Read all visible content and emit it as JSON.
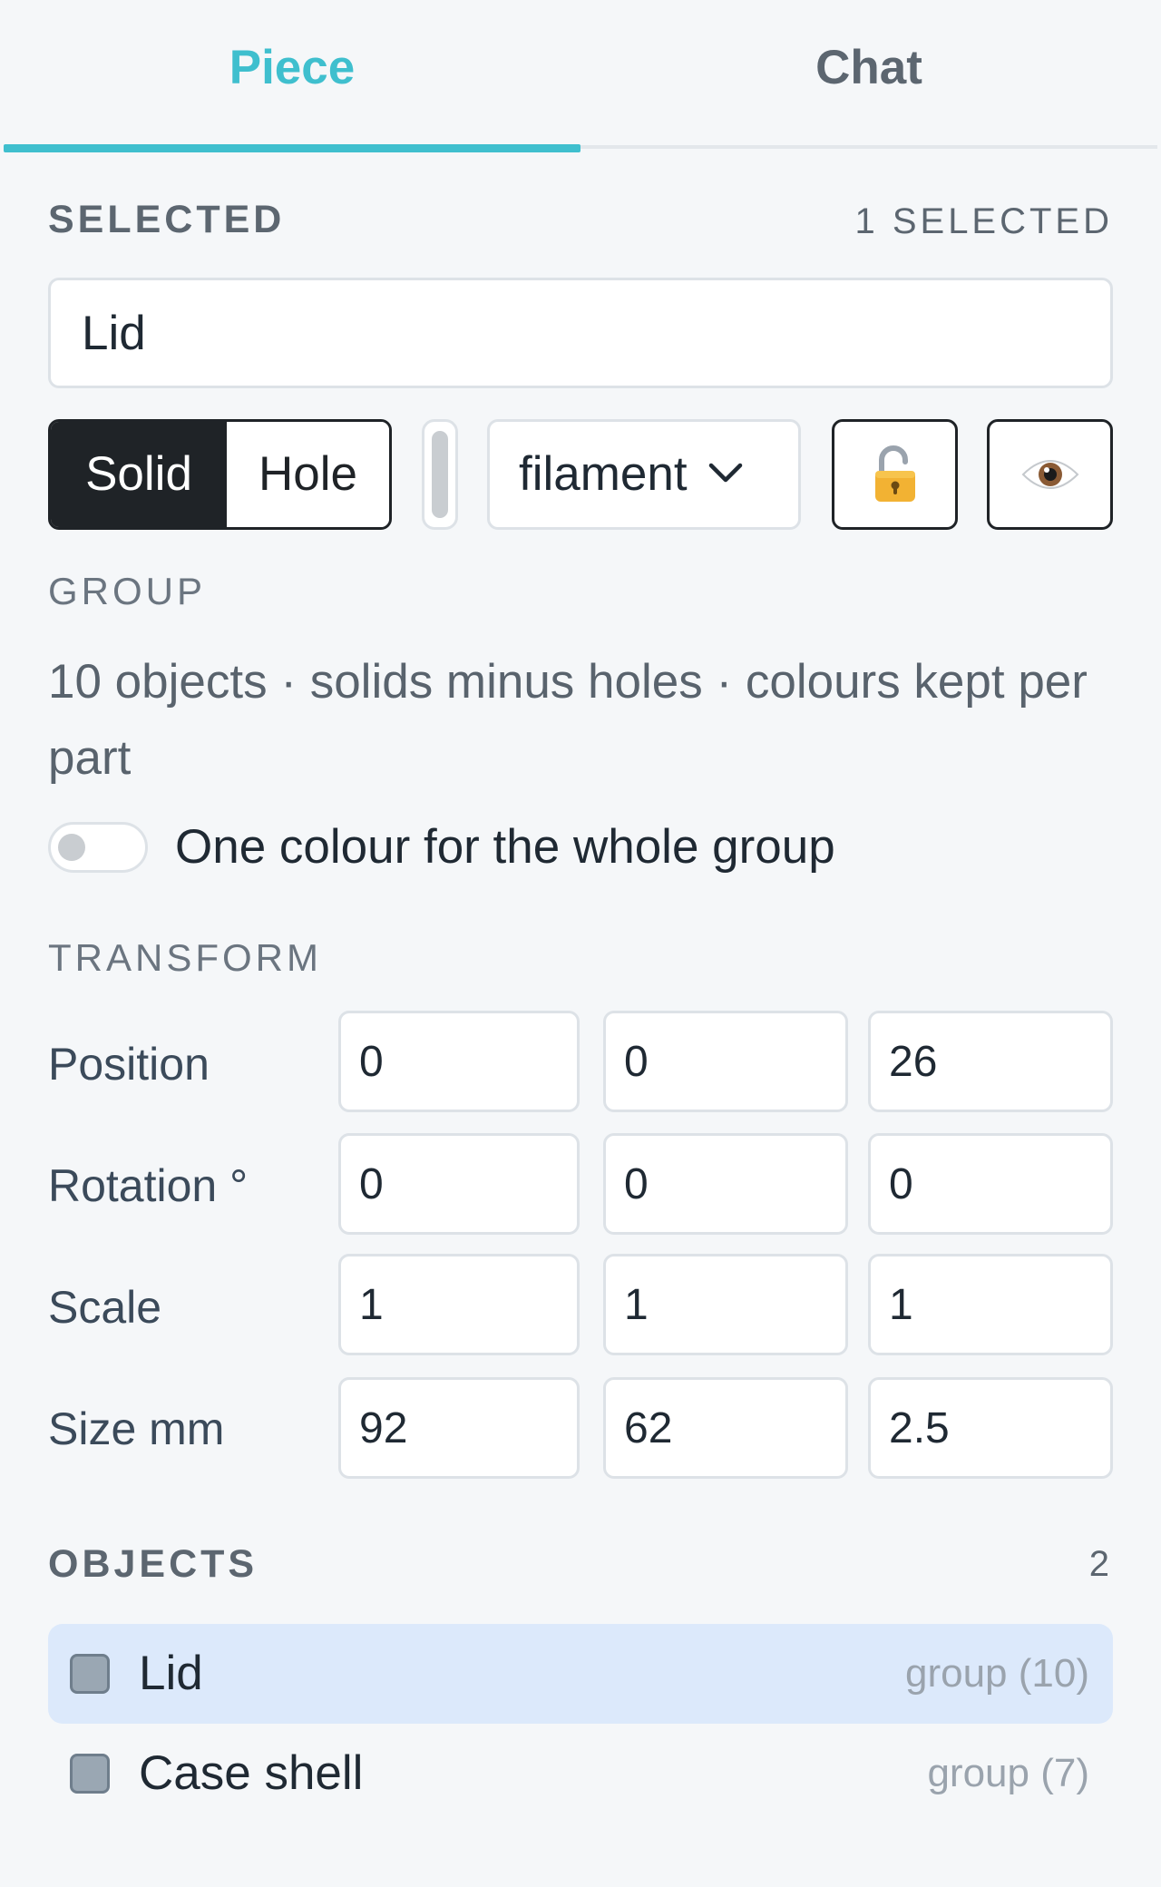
{
  "tabs": [
    {
      "label": "Piece",
      "active": true
    },
    {
      "label": "Chat",
      "active": false
    }
  ],
  "accent_color": "#3fbfce",
  "selected": {
    "heading": "SELECTED",
    "count_label": "1 SELECTED",
    "name_value": "Lid",
    "mode_options": [
      "Solid",
      "Hole"
    ],
    "mode_selected": "Solid",
    "material_value": "filament",
    "lock_icon": "unlocked-padlock-icon",
    "visibility_icon": "eye-icon"
  },
  "group": {
    "heading": "GROUP",
    "description": "10 objects · solids minus holes · colours kept per part",
    "toggle_label": "One colour for the whole group",
    "toggle_on": false
  },
  "transform": {
    "heading": "TRANSFORM",
    "rows": [
      {
        "label": "Position",
        "values": [
          "0",
          "0",
          "26"
        ]
      },
      {
        "label": "Rotation °",
        "values": [
          "0",
          "0",
          "0"
        ]
      },
      {
        "label": "Scale",
        "values": [
          "1",
          "1",
          "1"
        ]
      },
      {
        "label": "Size mm",
        "values": [
          "92",
          "62",
          "2.5"
        ]
      }
    ]
  },
  "objects": {
    "heading": "OBJECTS",
    "count": "2",
    "items": [
      {
        "name": "Lid",
        "meta": "group (10)",
        "selected": true
      },
      {
        "name": "Case shell",
        "meta": "group (7)",
        "selected": false
      }
    ]
  }
}
